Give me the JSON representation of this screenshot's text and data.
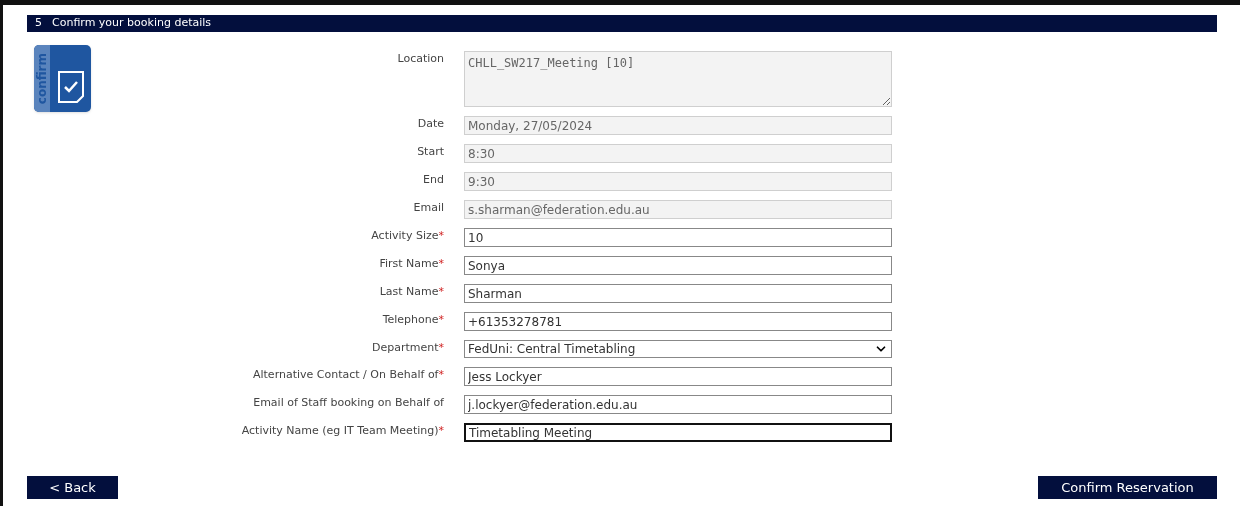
{
  "header": {
    "step": "5",
    "title": "Confirm your booking details"
  },
  "icon_label": "confirm",
  "fields": [
    {
      "kind": "textarea",
      "label": "Location",
      "readonly": true,
      "value": "CHLL_SW217_Meeting [10]"
    },
    {
      "kind": "text",
      "label": "Date",
      "readonly": true,
      "value": "Monday, 27/05/2024"
    },
    {
      "kind": "text",
      "label": "Start",
      "readonly": true,
      "value": "8:30"
    },
    {
      "kind": "text",
      "label": "End",
      "readonly": true,
      "value": "9:30"
    },
    {
      "kind": "text",
      "label": "Email",
      "readonly": true,
      "value": "s.sharman@federation.edu.au"
    },
    {
      "kind": "text",
      "label": "Activity Size",
      "required_mark": "*",
      "readonly": false,
      "value": "10"
    },
    {
      "kind": "text",
      "label": "First Name",
      "required_mark": "*",
      "readonly": false,
      "value": "Sonya"
    },
    {
      "kind": "text",
      "label": "Last Name",
      "required_mark": "*",
      "readonly": false,
      "value": "Sharman"
    },
    {
      "kind": "text",
      "label": "Telephone",
      "required_mark": "*",
      "readonly": false,
      "value": "+61353278781"
    },
    {
      "kind": "select",
      "label": "Department",
      "required_mark": "*",
      "readonly": false,
      "value": "FedUni: Central Timetabling"
    },
    {
      "kind": "text",
      "label": "Alternative Contact / On Behalf of",
      "required_mark": "*",
      "readonly": false,
      "value": "Jess Lockyer"
    },
    {
      "kind": "text",
      "label": "Email of Staff booking on Behalf of",
      "readonly": false,
      "value": "j.lockyer@federation.edu.au"
    },
    {
      "kind": "text",
      "label": "Activity Name (eg IT Team Meeting)",
      "required_mark": "*",
      "readonly": false,
      "focused": true,
      "value": "Timetabling Meeting"
    }
  ],
  "buttons": {
    "back": "< Back",
    "confirm": "Confirm Reservation"
  }
}
